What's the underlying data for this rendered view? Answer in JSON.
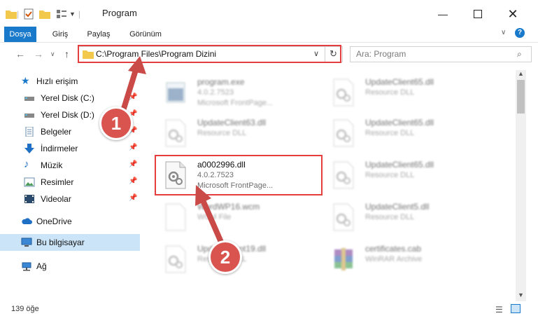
{
  "window": {
    "title": "Program"
  },
  "ribbon": {
    "tabs": [
      "Dosya",
      "Giriş",
      "Paylaş",
      "Görünüm"
    ]
  },
  "address": {
    "path": "C:\\Program Files\\Program Dizini"
  },
  "search": {
    "placeholder": "Ara: Program"
  },
  "sidebar": {
    "quick_access": "Hızlı erişim",
    "items": [
      "Yerel Disk (C:)",
      "Yerel Disk (D:)",
      "Belgeler",
      "İndirmeler",
      "Müzik",
      "Resimler",
      "Videolar"
    ],
    "onedrive": "OneDrive",
    "this_pc": "Bu bilgisayar",
    "network": "Ağ"
  },
  "files": [
    {
      "name": "program.exe",
      "version": "4.0.2.7523",
      "desc": "Microsoft FrontPage..."
    },
    {
      "name": "UpdateClient65.dll",
      "version": "",
      "desc": "Resource DLL"
    },
    {
      "name": "UpdateClient63.dll",
      "version": "",
      "desc": "Resource DLL"
    },
    {
      "name": "UpdateClient65.dll",
      "version": "",
      "desc": "Resource DLL"
    },
    {
      "name": "a0002996.dll",
      "version": "4.0.2.7523",
      "desc": "Microsoft FrontPage..."
    },
    {
      "name": "UpdateClient65.dll",
      "version": "",
      "desc": "Resource DLL"
    },
    {
      "name": "WordWP16.wcm",
      "version": "",
      "desc": "WCM File"
    },
    {
      "name": "UpdateClient5.dll",
      "version": "",
      "desc": "Resource DLL"
    },
    {
      "name": "UpdateClient19.dll",
      "version": "",
      "desc": "Resource DLL"
    },
    {
      "name": "certificates.cab",
      "version": "",
      "desc": "WinRAR Archive"
    }
  ],
  "status": {
    "count": "139 öğe"
  },
  "annotations": {
    "step1": "1",
    "step2": "2"
  },
  "colors": {
    "accent": "#1979ca",
    "highlight": "#e53e3e",
    "badge": "#d9534f"
  }
}
